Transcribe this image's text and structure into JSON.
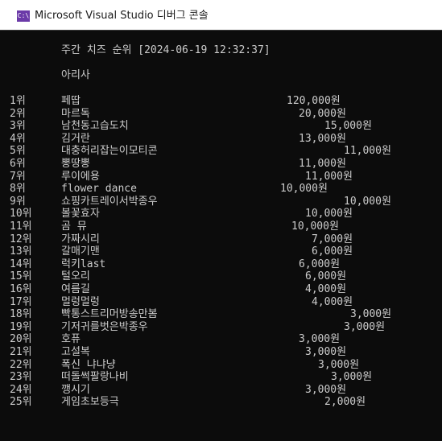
{
  "window": {
    "title": "Microsoft Visual Studio 디버그 콘솔",
    "icon": "C:\\"
  },
  "console": {
    "header": "주간 치즈 순위 [2024-06-19 12:32:37]",
    "channel": "아리사",
    "rows": [
      {
        "rank": "1위",
        "name": "페땁",
        "amount": "120,000원"
      },
      {
        "rank": "2위",
        "name": "마르독",
        "amount": "20,000원"
      },
      {
        "rank": "3위",
        "name": "남천동고습도치",
        "amount": "15,000원"
      },
      {
        "rank": "4위",
        "name": "김거란",
        "amount": "13,000원"
      },
      {
        "rank": "5위",
        "name": "대충허리잡는이모티콘",
        "amount": "11,000원"
      },
      {
        "rank": "6위",
        "name": "뽕땅뽕",
        "amount": "11,000원"
      },
      {
        "rank": "7위",
        "name": "루이에용",
        "amount": "11,000원"
      },
      {
        "rank": "8위",
        "name": "flower dance",
        "amount": "10,000원"
      },
      {
        "rank": "9위",
        "name": "쇼핑카트레이서박종우",
        "amount": "10,000원"
      },
      {
        "rank": "10위",
        "name": "볼꽃효자",
        "amount": "10,000원"
      },
      {
        "rank": "11위",
        "name": "곰 뮤",
        "amount": "10,000원"
      },
      {
        "rank": "12위",
        "name": "가짜시리",
        "amount": "7,000원"
      },
      {
        "rank": "13위",
        "name": "갈매기맨",
        "amount": "6,000원"
      },
      {
        "rank": "14위",
        "name": "럭키last",
        "amount": "6,000원"
      },
      {
        "rank": "15위",
        "name": "털오리",
        "amount": "6,000원"
      },
      {
        "rank": "16위",
        "name": "여름길",
        "amount": "4,000원"
      },
      {
        "rank": "17위",
        "name": "멀렁멀렁",
        "amount": "4,000원"
      },
      {
        "rank": "18위",
        "name": "빡통스트리머방송만봄",
        "amount": "3,000원"
      },
      {
        "rank": "19위",
        "name": "기저귀를벗은박종우",
        "amount": "3,000원"
      },
      {
        "rank": "20위",
        "name": "호퓨",
        "amount": "3,000원"
      },
      {
        "rank": "21위",
        "name": "고설복",
        "amount": "3,000원"
      },
      {
        "rank": "22위",
        "name": "폭신 냐냐냥",
        "amount": "3,000원"
      },
      {
        "rank": "23위",
        "name": "떠돌썩팔랑나비",
        "amount": "3,000원"
      },
      {
        "rank": "24위",
        "name": "깽시기",
        "amount": "3,000원"
      },
      {
        "rank": "25위",
        "name": "게임초보등극",
        "amount": "2,000원"
      }
    ]
  }
}
